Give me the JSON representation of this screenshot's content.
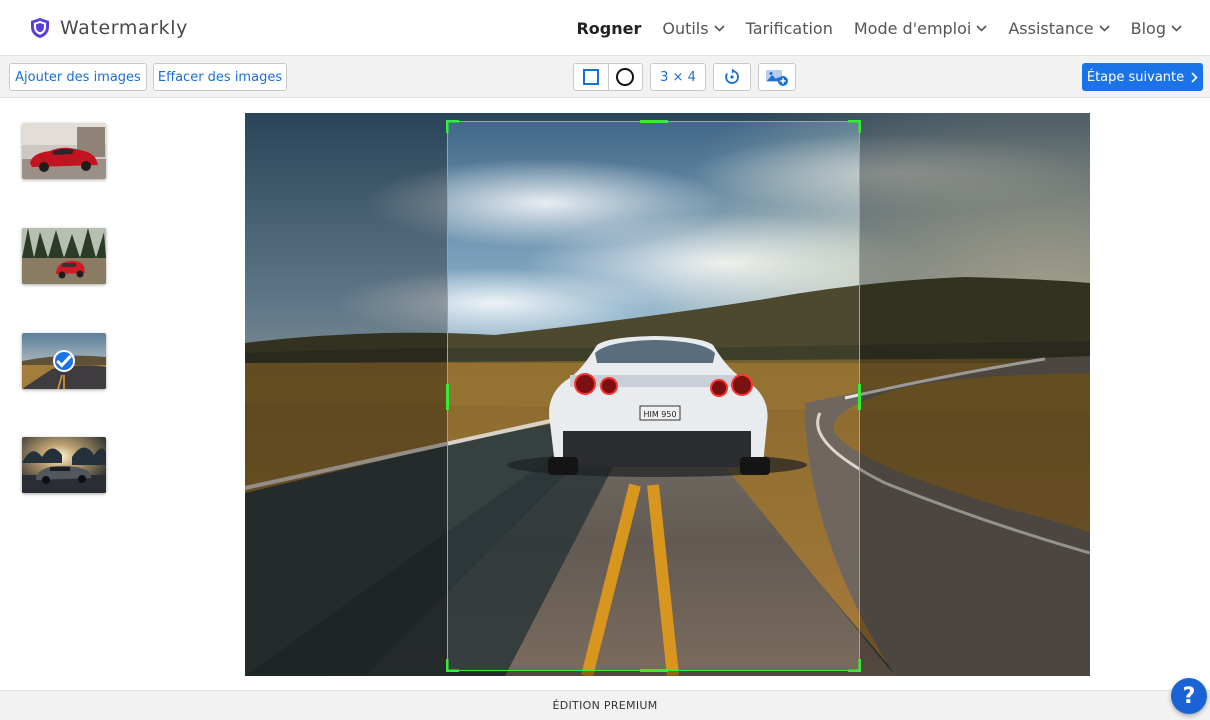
{
  "brand": {
    "name": "Watermarkly",
    "icon": "shield-icon",
    "color": "#5b3fd6"
  },
  "nav": {
    "items": [
      {
        "label": "Rogner",
        "active": true,
        "dropdown": false
      },
      {
        "label": "Outils",
        "dropdown": true
      },
      {
        "label": "Tarification",
        "dropdown": false
      },
      {
        "label": "Mode d'emploi",
        "dropdown": true
      },
      {
        "label": "Assistance",
        "dropdown": true
      },
      {
        "label": "Blog",
        "dropdown": true
      }
    ]
  },
  "toolbar": {
    "add_images": "Ajouter des images",
    "clear_images": "Effacer des images",
    "shape_rect": "rectangle-icon",
    "shape_circle": "circle-icon",
    "ratio": "3 × 4",
    "rotate_icon": "rotate-icon",
    "add_photo_icon": "add-photo-icon",
    "next": "Étape suivante",
    "accent": "#1a73e8"
  },
  "thumbnails": [
    {
      "subject": "red-classic-car",
      "selected": false
    },
    {
      "subject": "red-car-forest",
      "selected": false
    },
    {
      "subject": "road-sunset",
      "selected": true
    },
    {
      "subject": "dark-car-sunset",
      "selected": false
    }
  ],
  "crop": {
    "ratio": "3 × 4",
    "handle_color": "#33ee33"
  },
  "footer": {
    "edition": "ÉDITION PREMIUM"
  },
  "help": {
    "label": "?"
  }
}
